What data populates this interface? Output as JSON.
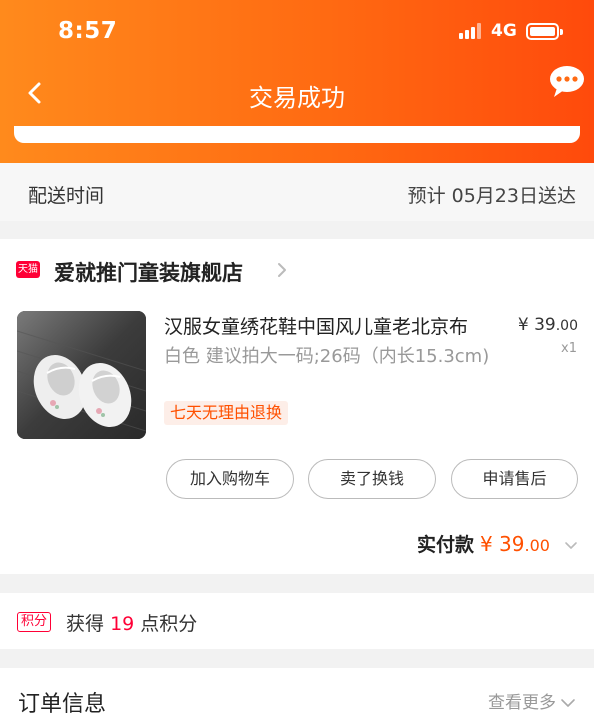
{
  "status_bar": {
    "time": "8:57",
    "network": "4G"
  },
  "header": {
    "title": "交易成功"
  },
  "delivery": {
    "label": "配送时间",
    "value": "预计 05月23日送达"
  },
  "shop": {
    "badge": "天猫",
    "name": "爱就推门童装旗舰店"
  },
  "product": {
    "title": "汉服女童绣花鞋中国风儿童老北京布",
    "price_symbol": "¥",
    "price_int": "39",
    "price_dec": ".00",
    "quantity": "x1",
    "sku": "白色 建议拍大一码;26码（内长15.3cm)",
    "tag": "七天无理由退换"
  },
  "actions": [
    {
      "label": "加入购物车"
    },
    {
      "label": "卖了换钱"
    },
    {
      "label": "申请售后"
    }
  ],
  "payment": {
    "label": "实付款",
    "symbol": "¥",
    "int": "39",
    "dec": ".00"
  },
  "points": {
    "badge": "积分",
    "prefix": "获得",
    "value": "19",
    "suffix": "点积分"
  },
  "order_info": {
    "title": "订单信息",
    "more": "查看更多"
  },
  "colors": {
    "accent": "#ff5000",
    "tmall_red": "#ff0036",
    "header_start": "#ff8a1c",
    "header_end": "#ff4a0c"
  }
}
